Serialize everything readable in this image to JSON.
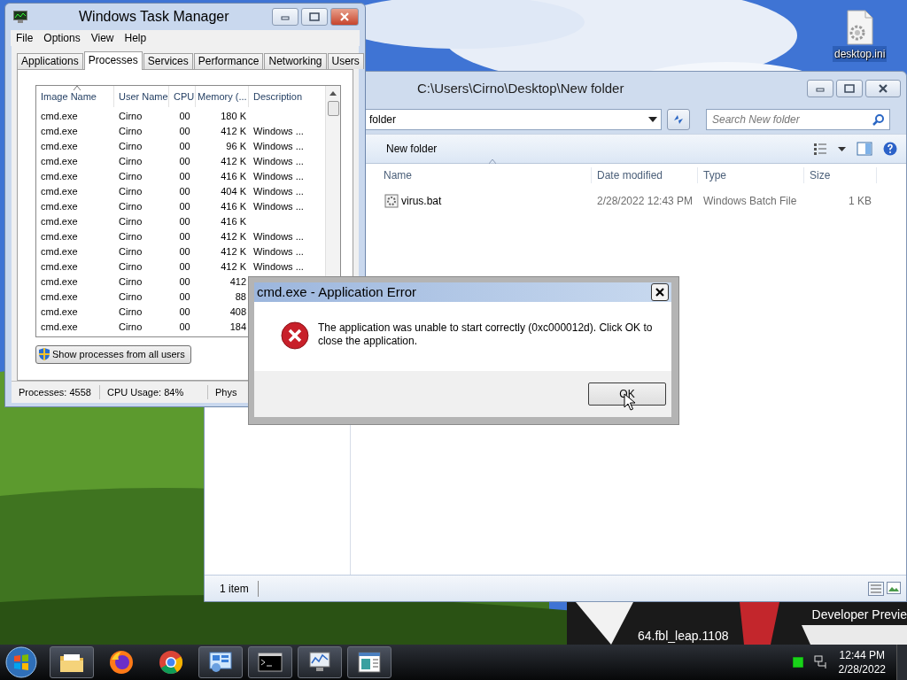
{
  "desktop": {
    "icons": [
      {
        "label": "desktop.ini"
      }
    ],
    "watermark": [
      "Developer Previe",
      "64.fbl_leap.1108"
    ]
  },
  "explorer": {
    "title": "C:\\Users\\Cirno\\Desktop\\New folder",
    "address": "folder",
    "search": {
      "placeholder": "Search New folder"
    },
    "toolbar": [
      "New folder"
    ],
    "columns": [
      "Name",
      "Date modified",
      "Type",
      "Size"
    ],
    "files": [
      {
        "name": "virus.bat",
        "date": "2/28/2022 12:43 PM",
        "type": "Windows Batch File",
        "size": "1 KB"
      }
    ],
    "status": "1 item"
  },
  "task_manager": {
    "title": "Windows Task Manager",
    "menu": [
      "File",
      "Options",
      "View",
      "Help"
    ],
    "tabs": [
      {
        "label": "Applications",
        "selected": false
      },
      {
        "label": "Processes",
        "selected": true
      },
      {
        "label": "Services",
        "selected": false
      },
      {
        "label": "Performance",
        "selected": false
      },
      {
        "label": "Networking",
        "selected": false
      },
      {
        "label": "Users",
        "selected": false
      }
    ],
    "columns": [
      "Image Name",
      "User Name",
      "CPU",
      "Memory (...",
      "Description"
    ],
    "rows": [
      {
        "image": "cmd.exe",
        "user": "Cirno",
        "cpu": "00",
        "memory": "180 K"
      },
      {
        "image": "cmd.exe",
        "user": "Cirno",
        "cpu": "00",
        "memory": "412 K",
        "description": "Windows ..."
      },
      {
        "image": "cmd.exe",
        "user": "Cirno",
        "cpu": "00",
        "memory": "96 K",
        "description": "Windows ..."
      },
      {
        "image": "cmd.exe",
        "user": "Cirno",
        "cpu": "00",
        "memory": "412 K",
        "description": "Windows ..."
      },
      {
        "image": "cmd.exe",
        "user": "Cirno",
        "cpu": "00",
        "memory": "416 K",
        "description": "Windows ..."
      },
      {
        "image": "cmd.exe",
        "user": "Cirno",
        "cpu": "00",
        "memory": "404 K",
        "description": "Windows ..."
      },
      {
        "image": "cmd.exe",
        "user": "Cirno",
        "cpu": "00",
        "memory": "416 K",
        "description": "Windows ..."
      },
      {
        "image": "cmd.exe",
        "user": "Cirno",
        "cpu": "00",
        "memory": "416 K"
      },
      {
        "image": "cmd.exe",
        "user": "Cirno",
        "cpu": "00",
        "memory": "412 K",
        "description": "Windows ..."
      },
      {
        "image": "cmd.exe",
        "user": "Cirno",
        "cpu": "00",
        "memory": "412 K",
        "description": "Windows ..."
      },
      {
        "image": "cmd.exe",
        "user": "Cirno",
        "cpu": "00",
        "memory": "412 K",
        "description": "Windows ..."
      },
      {
        "image": "cmd.exe",
        "user": "Cirno",
        "cpu": "00",
        "memory": "412"
      },
      {
        "image": "cmd.exe",
        "user": "Cirno",
        "cpu": "00",
        "memory": "88"
      },
      {
        "image": "cmd.exe",
        "user": "Cirno",
        "cpu": "00",
        "memory": "408"
      },
      {
        "image": "cmd.exe",
        "user": "Cirno",
        "cpu": "00",
        "memory": "184"
      }
    ],
    "button": "Show processes from all users",
    "status": [
      "Processes: 4558",
      "CPU Usage: 84%",
      "Phys"
    ]
  },
  "dialog": {
    "title": "cmd.exe - Application Error",
    "message": "The application was unable to start correctly (0xc000012d). Click OK to close the application.",
    "button": "OK"
  },
  "taskbar": {
    "items": [
      {
        "kind": "folder",
        "running": true
      },
      {
        "kind": "firefox",
        "running": false
      },
      {
        "kind": "chrome",
        "running": false
      },
      {
        "kind": "control-panel",
        "running": true
      },
      {
        "kind": "console",
        "running": true
      },
      {
        "kind": "monitor",
        "running": true
      },
      {
        "kind": "window",
        "running": true
      }
    ],
    "clock": {
      "time": "12:44 PM",
      "date": "2/28/2022"
    }
  }
}
